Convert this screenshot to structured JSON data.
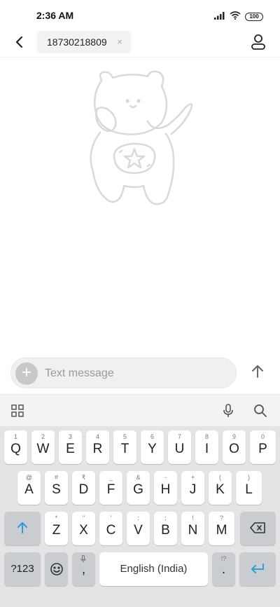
{
  "status_bar": {
    "time": "2:36 AM",
    "battery": "100",
    "icons": [
      "signal-icon",
      "wifi-icon",
      "battery-icon"
    ]
  },
  "header": {
    "recipient": "18730218809",
    "remove_symbol": "×",
    "icons": [
      "back-arrow-icon",
      "contact-icon"
    ]
  },
  "compose": {
    "placeholder": "Text message",
    "attach_symbol": "+",
    "icons": [
      "add-attachment-icon",
      "send-arrow-icon"
    ]
  },
  "keyboard_toolbar": {
    "icons": [
      "apps-grid-icon",
      "microphone-icon",
      "search-icon"
    ]
  },
  "keyboard": {
    "row1": [
      {
        "main": "Q",
        "hint": "1"
      },
      {
        "main": "W",
        "hint": "2"
      },
      {
        "main": "E",
        "hint": "3"
      },
      {
        "main": "R",
        "hint": "4"
      },
      {
        "main": "T",
        "hint": "5"
      },
      {
        "main": "Y",
        "hint": "6"
      },
      {
        "main": "U",
        "hint": "7"
      },
      {
        "main": "I",
        "hint": "8"
      },
      {
        "main": "O",
        "hint": "9"
      },
      {
        "main": "P",
        "hint": "0"
      }
    ],
    "row2": [
      {
        "main": "A",
        "hint": "@"
      },
      {
        "main": "S",
        "hint": "#"
      },
      {
        "main": "D",
        "hint": "₹"
      },
      {
        "main": "F",
        "hint": "_"
      },
      {
        "main": "G",
        "hint": "&"
      },
      {
        "main": "H",
        "hint": "-"
      },
      {
        "main": "J",
        "hint": "+"
      },
      {
        "main": "K",
        "hint": "("
      },
      {
        "main": "L",
        "hint": ")"
      }
    ],
    "row3": [
      {
        "main": "Z",
        "hint": "*"
      },
      {
        "main": "X",
        "hint": "\""
      },
      {
        "main": "C",
        "hint": "'"
      },
      {
        "main": "V",
        "hint": ":"
      },
      {
        "main": "B",
        "hint": ";"
      },
      {
        "main": "N",
        "hint": "!"
      },
      {
        "main": "M",
        "hint": "?"
      }
    ],
    "symbols_label": "?123",
    "comma": ",",
    "space_label": "English (India)",
    "period": ".",
    "period_hint": "!?",
    "icons": [
      "shift-icon",
      "backspace-icon",
      "emoji-icon",
      "enter-icon"
    ],
    "accent_color": "#2a9fd6"
  }
}
